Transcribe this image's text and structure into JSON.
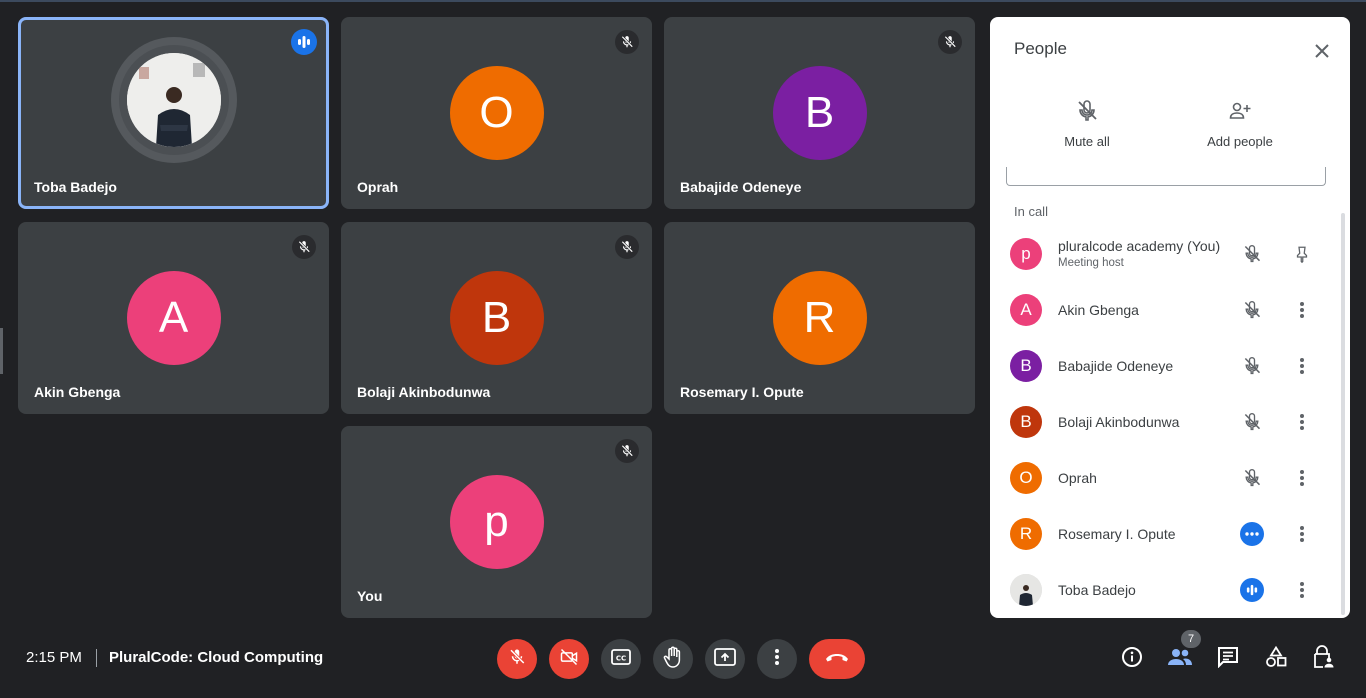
{
  "tiles": [
    {
      "name": "Toba Badejo",
      "type": "photo",
      "status": "speaking"
    },
    {
      "name": "Oprah",
      "initial": "O",
      "color": "#ef6c00",
      "status": "muted"
    },
    {
      "name": "Babajide Odeneye",
      "initial": "B",
      "color": "#7b1fa2",
      "status": "muted"
    },
    {
      "name": "Akin Gbenga",
      "initial": "A",
      "color": "#ec407a",
      "status": "muted"
    },
    {
      "name": "Bolaji Akinbodunwa",
      "initial": "B",
      "color": "#bf360c",
      "status": "muted"
    },
    {
      "name": "Rosemary I. Opute",
      "initial": "R",
      "color": "#ef6c00",
      "status": "muted"
    },
    {
      "name": "You",
      "initial": "p",
      "color": "#ec407a",
      "status": "muted"
    }
  ],
  "panel": {
    "title": "People",
    "mute_all": "Mute all",
    "add_people": "Add people",
    "in_call": "In call",
    "people": [
      {
        "name": "pluralcode academy (You)",
        "sub": "Meeting host",
        "initial": "p",
        "color": "#ec407a",
        "status": "muted",
        "action": "pin-icon"
      },
      {
        "name": "Akin Gbenga",
        "initial": "A",
        "color": "#ec407a",
        "status": "muted",
        "action": "more-icon"
      },
      {
        "name": "Babajide Odeneye",
        "initial": "B",
        "color": "#7b1fa2",
        "status": "muted",
        "action": "more-icon"
      },
      {
        "name": "Bolaji Akinbodunwa",
        "initial": "B",
        "color": "#bf360c",
        "status": "muted",
        "action": "more-icon"
      },
      {
        "name": "Oprah",
        "initial": "O",
        "color": "#ef6c00",
        "status": "muted",
        "action": "more-icon"
      },
      {
        "name": "Rosemary I. Opute",
        "initial": "R",
        "color": "#ef6c00",
        "status": "connecting",
        "action": "more-icon"
      },
      {
        "name": "Toba Badejo",
        "initial": "",
        "color": "#d9d9d9",
        "status": "speaking",
        "action": "more-icon"
      }
    ]
  },
  "bottom": {
    "time": "2:15 PM",
    "meeting_title": "PluralCode: Cloud Computing",
    "people_count": "7"
  },
  "colors": {
    "accent": "#1a73e8",
    "danger": "#ea4335",
    "tile_bg": "#3c4043",
    "page_bg": "#202124"
  }
}
